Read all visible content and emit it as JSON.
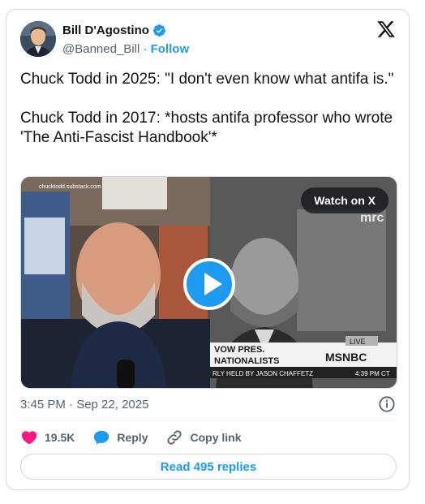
{
  "author": {
    "name": "Bill D'Agostino",
    "handle": "@Banned_Bill",
    "separator": "·",
    "follow_label": "Follow"
  },
  "tweet": {
    "text": "Chuck Todd in 2025: \"I don't even know what antifa is.\"\n\nChuck Todd in 2017: *hosts antifa professor who wrote 'The Anti-Fascist Handbook'*",
    "timestamp": "3:45 PM · Sep 22, 2025"
  },
  "media": {
    "watch_label": "Watch on X",
    "overlay": {
      "watermark": "chucktodd.substack.com",
      "channel_mark": "mrc",
      "live_badge": "LIVE",
      "lower_third_line1": "VOW PRES.",
      "lower_third_line2": "NATIONALISTS",
      "network": "MSNBC",
      "ticker": "RLY HELD BY JASON CHAFFETZ",
      "clock": "4:39 PM CT"
    }
  },
  "actions": {
    "likes": "19.5K",
    "reply_label": "Reply",
    "copy_link_label": "Copy link",
    "read_replies_label": "Read 495 replies"
  },
  "colors": {
    "accent": "#1d9bf0",
    "like": "#f91880",
    "text": "#0f1419",
    "muted": "#536471",
    "border": "#cfd9de"
  }
}
